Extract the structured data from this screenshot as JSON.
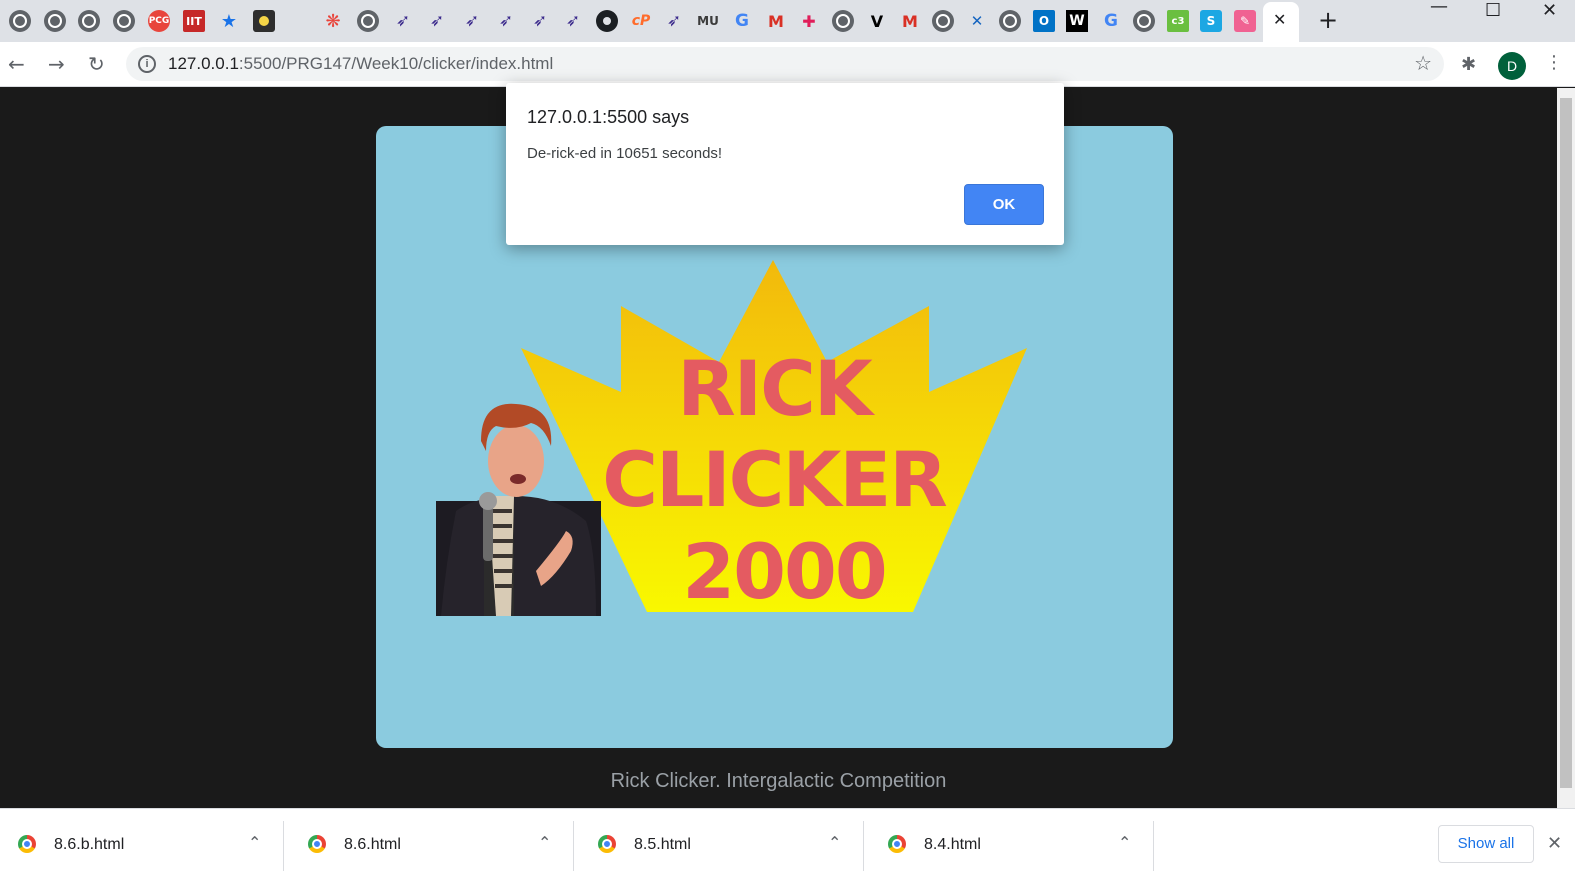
{
  "browser": {
    "url_host": "127.0.0.1",
    "url_rest": ":5500/PRG147/Week10/clicker/index.html",
    "profile_initial": "D",
    "tab_icons": [
      "globe-icon",
      "globe-icon",
      "globe-icon",
      "globe-icon",
      "pcg-icon",
      "iit-icon",
      "star-icon",
      "xbox-icon",
      "",
      "flower-icon",
      "globe-icon",
      "feather-icon",
      "feather-icon",
      "feather-icon",
      "feather-icon",
      "feather-icon",
      "feather-icon",
      "github-icon",
      "cp-icon",
      "feather-icon",
      "mu-icon",
      "google-icon",
      "gmail-icon",
      "slack-icon",
      "globe-icon",
      "v-icon",
      "gmail-icon",
      "globe-icon",
      "x-icon",
      "globe-icon",
      "outlook-icon",
      "wikipedia-icon",
      "google-icon",
      "globe-icon",
      "green-icon",
      "s-icon",
      "pink-icon"
    ],
    "tab_texts": {
      "pcg": "PCG",
      "iit": "IIT",
      "mu": "MU",
      "w": "W",
      "o": "O",
      "s": "S",
      "green": "c3",
      "v": "V",
      "g": "G",
      "m": "M"
    }
  },
  "page": {
    "footer": "Rick Clicker. Intergalactic Competition",
    "logo_lines": [
      "RICK",
      "CLICKER",
      "2000"
    ]
  },
  "alert": {
    "title": "127.0.0.1:5500 says",
    "message": "De-rick-ed in 10651 seconds!",
    "ok_label": "OK"
  },
  "downloads": {
    "items": [
      "8.6.b.html",
      "8.6.html",
      "8.5.html",
      "8.4.html"
    ],
    "show_all_label": "Show all"
  },
  "colors": {
    "card_bg": "#8bcbdf",
    "crown_top": "#f2b90c",
    "crown_bottom": "#f9f800",
    "logo_text": "#e45b61",
    "ok_button": "#4285f4"
  }
}
